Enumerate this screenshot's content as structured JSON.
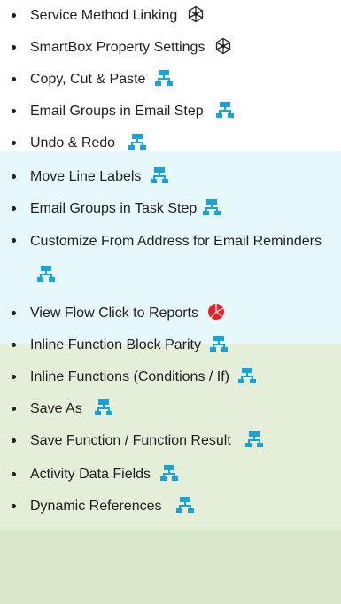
{
  "items": [
    {
      "label": "Service Method Linking",
      "icon": "network-icon"
    },
    {
      "label": "SmartBox Property Settings",
      "icon": "network-icon"
    },
    {
      "label": "Copy, Cut & Paste",
      "icon": "flowchart-icon"
    },
    {
      "label": "Email Groups in Email Step",
      "icon": "flowchart-icon"
    },
    {
      "label": "Undo & Redo",
      "icon": "flowchart-icon"
    },
    {
      "label": "Move Line Labels",
      "icon": "flowchart-icon"
    },
    {
      "label": "Email Groups in Task Step",
      "icon": "flowchart-icon"
    },
    {
      "label": "Customize From Address for Email Reminders",
      "icon": "flowchart-icon"
    },
    {
      "label": "View Flow Click to Reports",
      "icon": "pie-chart-icon"
    },
    {
      "label": "Inline Function Block Parity",
      "icon": "flowchart-icon"
    },
    {
      "label": "Inline Functions (Conditions / If)",
      "icon": "flowchart-icon"
    },
    {
      "label": "Save As",
      "icon": "flowchart-icon"
    },
    {
      "label": "Save Function / Function Result",
      "icon": "flowchart-icon"
    },
    {
      "label": "Activity Data Fields",
      "icon": "flowchart-icon"
    },
    {
      "label": "Dynamic References",
      "icon": "flowchart-icon"
    }
  ],
  "colors": {
    "flowchart_icon": "#1aa3d8",
    "pie_icon": "#e8202a",
    "band_cyan": "#e6f8fc",
    "band_green": "#e4eed9"
  }
}
